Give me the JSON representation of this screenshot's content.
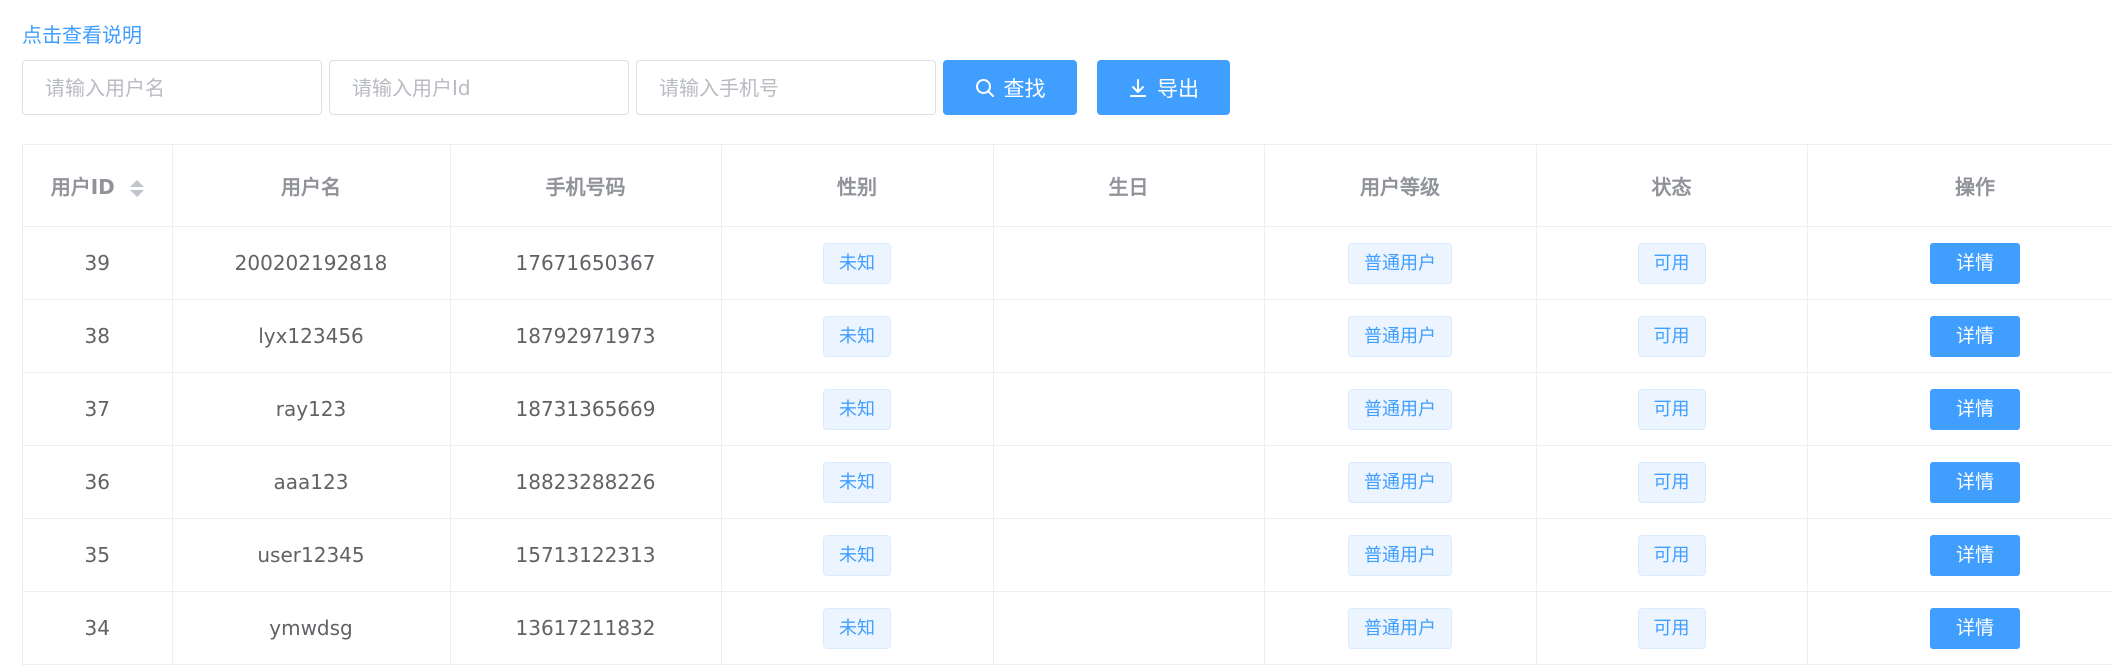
{
  "help_link": "点击查看说明",
  "search": {
    "username_placeholder": "请输入用户名",
    "userid_placeholder": "请输入用户Id",
    "phone_placeholder": "请输入手机号",
    "search_label": "查找",
    "export_label": "导出"
  },
  "colors": {
    "primary": "#409eff",
    "tag_bg": "#ecf5ff",
    "header_text": "#909399",
    "body_text": "#606266",
    "border": "#ebeef5"
  },
  "table": {
    "headers": {
      "id": "用户ID",
      "username": "用户名",
      "phone": "手机号码",
      "gender": "性别",
      "birthday": "生日",
      "level": "用户等级",
      "status": "状态",
      "action": "操作"
    },
    "rows": [
      {
        "id": "39",
        "username": "200202192818",
        "phone": "17671650367",
        "gender": "未知",
        "birthday": "",
        "level": "普通用户",
        "status": "可用",
        "action": "详情"
      },
      {
        "id": "38",
        "username": "lyx123456",
        "phone": "18792971973",
        "gender": "未知",
        "birthday": "",
        "level": "普通用户",
        "status": "可用",
        "action": "详情"
      },
      {
        "id": "37",
        "username": "ray123",
        "phone": "18731365669",
        "gender": "未知",
        "birthday": "",
        "level": "普通用户",
        "status": "可用",
        "action": "详情"
      },
      {
        "id": "36",
        "username": "aaa123",
        "phone": "18823288226",
        "gender": "未知",
        "birthday": "",
        "level": "普通用户",
        "status": "可用",
        "action": "详情"
      },
      {
        "id": "35",
        "username": "user12345",
        "phone": "15713122313",
        "gender": "未知",
        "birthday": "",
        "level": "普通用户",
        "status": "可用",
        "action": "详情"
      },
      {
        "id": "34",
        "username": "ymwdsg",
        "phone": "13617211832",
        "gender": "未知",
        "birthday": "",
        "level": "普通用户",
        "status": "可用",
        "action": "详情"
      }
    ]
  }
}
